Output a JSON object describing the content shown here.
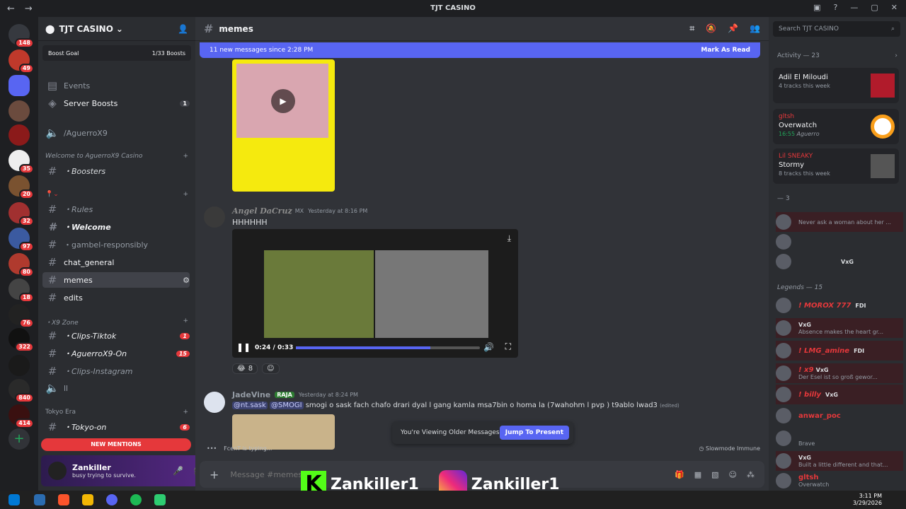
{
  "window": {
    "title": "TJT CASINO"
  },
  "server": {
    "name": "TJT CASINO",
    "boost_label": "Boost Goal",
    "boost_count": "1/33 Boosts"
  },
  "server_badges": [
    "148",
    "49",
    "35",
    "20",
    "32",
    "97",
    "80",
    "18",
    "76",
    "322",
    "840",
    "414"
  ],
  "channels": {
    "events": "Events",
    "server_boosts": "Server Boosts",
    "server_boosts_count": "1",
    "voice_aguerro": "/AguerroX9",
    "cat_welcome": "Welcome to AguerroX9 Casino",
    "boosters": "・Boosters",
    "rules": "・Rules",
    "welcome": "・Welcome",
    "gambel": "・gambel-responsibly",
    "chat_general": "chat_general",
    "memes": "memes",
    "edits": "edits",
    "cat_x9": "・X9 Zone",
    "clips_tiktok": "・Clips-Tiktok",
    "clips_tiktok_count": "1",
    "aguerro_on": "・AguerroX9-On",
    "aguerro_on_count": "15",
    "clips_instagram": "・Clips-Instagram",
    "voice_ll": "ll",
    "cat_tokyo": "Tokyo Era",
    "tokyo_on": "・Tokyo-on",
    "tokyo_on_count": "6",
    "new_mentions": "NEW MENTIONS"
  },
  "user": {
    "name": "Zankiller",
    "status": "busy trying to survive."
  },
  "main": {
    "channel": "memes",
    "new_messages": "11 new messages since 2:28 PM",
    "mark_read": "Mark As Read",
    "messages": [
      {
        "author": "Angel DaCruz",
        "tag": "MX",
        "time": "Yesterday at 8:16 PM",
        "text": "HHHHHH",
        "video_time": "0:24 / 0:33",
        "reaction_count": "8"
      },
      {
        "author": "JadeVine",
        "tag": "RAJA",
        "time": "Yesterday at 8:24 PM",
        "mention1": "@nt.sask",
        "mention2": "@SMOGI",
        "text": "smogi o sask fach chafo drari dyal l gang kamla msa7bin o homa la (7wahohm l pvp ) t9ablo lwad3",
        "edited": "(edited)"
      }
    ],
    "older_notice": "You're Viewing Older Messages",
    "jump": "Jump To Present",
    "typing": "FcenT is typing...",
    "slowmode": "Slowmode Immune",
    "input_placeholder": "Message #memes"
  },
  "right": {
    "search_placeholder": "Search TJT CASINO",
    "activity_header": "Activity — 23",
    "activities": [
      {
        "user": "",
        "title": "Adil El Miloudi",
        "sub": "4 tracks this week"
      },
      {
        "user": "gltsh",
        "title": "Overwatch",
        "sub": "16:55",
        "sub2": "Aguerro"
      },
      {
        "user": "Lil SNEAKY",
        "title": "Stormy",
        "sub": "8 tracks this week"
      }
    ],
    "group1": "— 3",
    "group1_members": [
      {
        "name": "",
        "status": "Never ask a woman about her ..."
      },
      {
        "name": "",
        "status": ""
      },
      {
        "name": "",
        "tag": "VxG",
        "status": ""
      }
    ],
    "group2": "Legends — 15",
    "group2_members": [
      {
        "name": "! MOROX 777",
        "tag": "FDI",
        "status": ""
      },
      {
        "name": "",
        "tag": "VxG",
        "status": "Absence makes the heart gr..."
      },
      {
        "name": "! LMG_amine",
        "tag": "FDI",
        "status": ""
      },
      {
        "name": "! x9",
        "tag": "VxG",
        "status": "Der Esel ist so groß gewor..."
      },
      {
        "name": "! billy",
        "tag": "VxG",
        "status": ""
      },
      {
        "name": "anwar_poc",
        "tag": "",
        "status": ""
      },
      {
        "name": "",
        "tag": "",
        "status": "Brave"
      },
      {
        "name": "",
        "tag": "VxG",
        "status": "Built a little different and that..."
      },
      {
        "name": "gltsh",
        "tag": "",
        "status": "Overwatch"
      }
    ]
  },
  "overlay": {
    "kick": "Zankiller1",
    "instagram": "Zankiller1"
  },
  "taskbar": {
    "time": "3:11 PM",
    "date": "3/29/2026"
  }
}
